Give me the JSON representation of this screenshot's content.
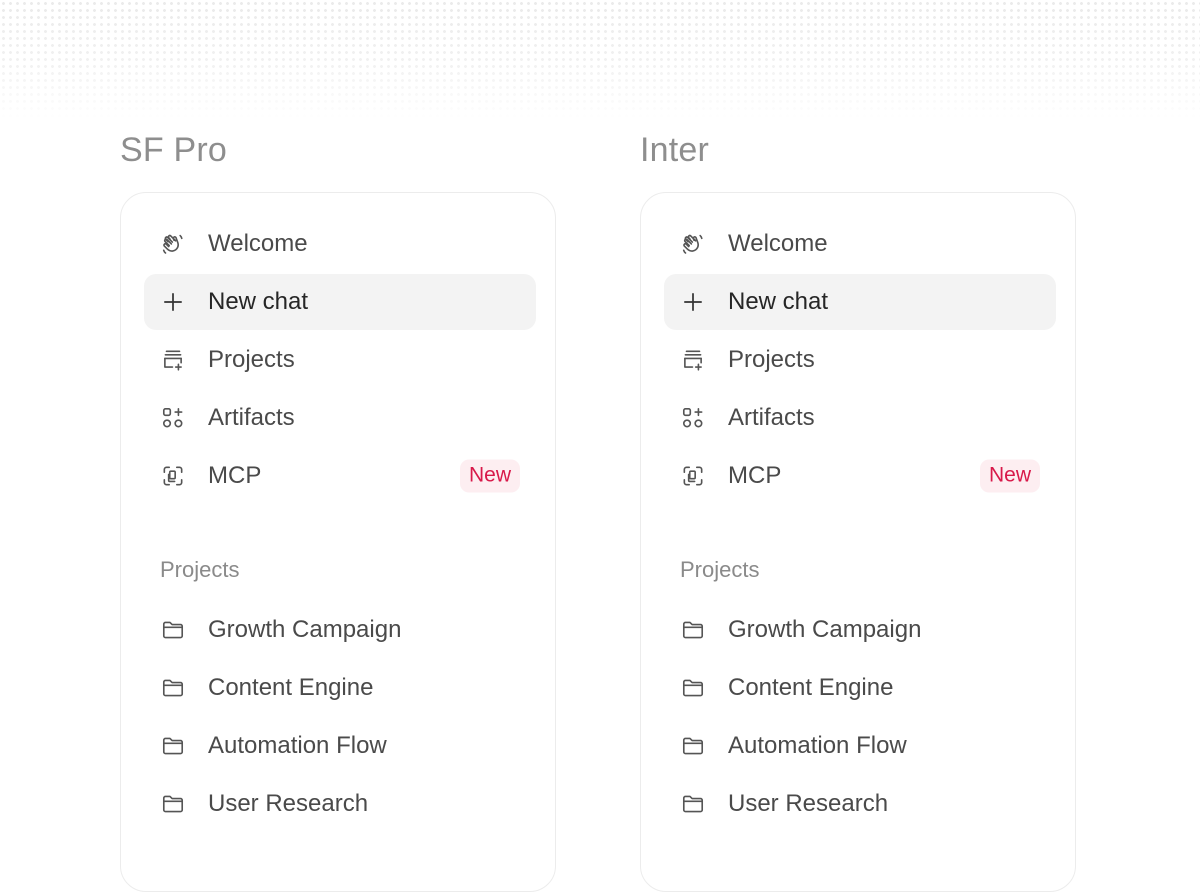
{
  "columns": [
    {
      "font_label": "SF Pro",
      "nav": [
        {
          "label": "Welcome",
          "icon": "wave-icon",
          "active": false
        },
        {
          "label": "New chat",
          "icon": "plus-icon",
          "active": true
        },
        {
          "label": "Projects",
          "icon": "projects-icon",
          "active": false
        },
        {
          "label": "Artifacts",
          "icon": "artifacts-icon",
          "active": false
        },
        {
          "label": "MCP",
          "icon": "mcp-icon",
          "active": false,
          "badge": "New"
        }
      ],
      "projects_title": "Projects",
      "projects": [
        {
          "label": "Growth Campaign",
          "icon": "folder-icon"
        },
        {
          "label": "Content Engine",
          "icon": "folder-icon"
        },
        {
          "label": "Automation Flow",
          "icon": "folder-icon"
        },
        {
          "label": "User Research",
          "icon": "folder-icon"
        }
      ]
    },
    {
      "font_label": "Inter",
      "nav": [
        {
          "label": "Welcome",
          "icon": "wave-icon",
          "active": false
        },
        {
          "label": "New chat",
          "icon": "plus-icon",
          "active": true
        },
        {
          "label": "Projects",
          "icon": "projects-icon",
          "active": false
        },
        {
          "label": "Artifacts",
          "icon": "artifacts-icon",
          "active": false
        },
        {
          "label": "MCP",
          "icon": "mcp-icon",
          "active": false,
          "badge": "New"
        }
      ],
      "projects_title": "Projects",
      "projects": [
        {
          "label": "Growth Campaign",
          "icon": "folder-icon"
        },
        {
          "label": "Content Engine",
          "icon": "folder-icon"
        },
        {
          "label": "Automation Flow",
          "icon": "folder-icon"
        },
        {
          "label": "User Research",
          "icon": "folder-icon"
        }
      ]
    }
  ],
  "colors": {
    "active_bg": "#f3f3f3",
    "badge_bg": "#fdeef1",
    "badge_text": "#d8194a",
    "label_muted": "#8e8e8e",
    "panel_border": "#ececec"
  }
}
